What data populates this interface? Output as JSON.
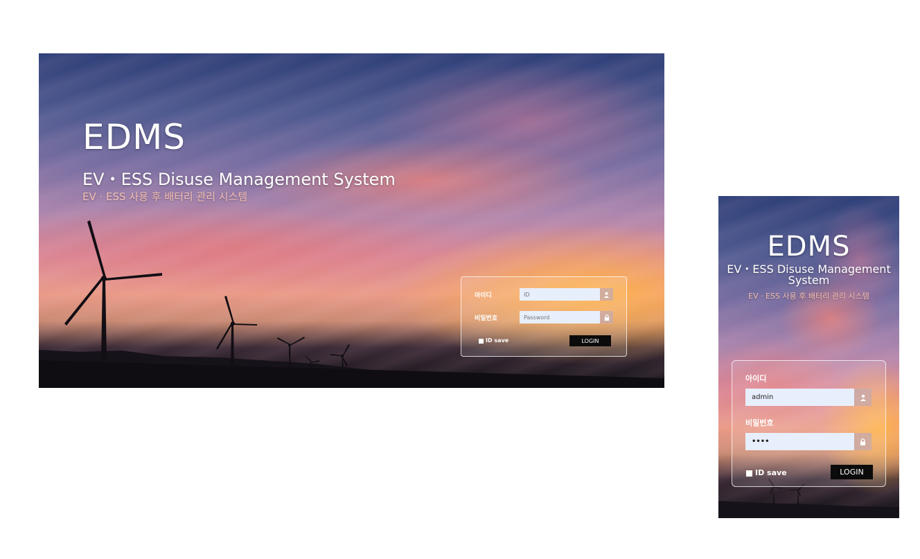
{
  "desktop": {
    "title": "EDMS",
    "subtitle": "EV・ESS Disuse Management System",
    "subtitle_ko": "EV · ESS 사용 후 배터리 관리 시스템",
    "login": {
      "id_label": "아이디",
      "id_value": "",
      "id_placeholder": "ID",
      "password_label": "비밀번호",
      "password_value": "",
      "password_placeholder": "Password",
      "id_save_label": "ID save",
      "login_button": "LOGIN",
      "id_icon": "user-icon",
      "password_icon": "lock-icon"
    }
  },
  "mobile": {
    "title": "EDMS",
    "subtitle": "EV・ESS Disuse Management System",
    "subtitle_ko": "EV · ESS 사용 후 배터리 관리 시스템",
    "login": {
      "id_label": "아이디",
      "id_value": "admin",
      "password_label": "비밀번호",
      "password_value": "••••",
      "id_save_label": "ID save",
      "login_button": "LOGIN",
      "id_icon": "user-icon",
      "password_icon": "lock-icon"
    }
  },
  "colors": {
    "subtitle_ko": "#f4c0b4",
    "input_bg": "#e8effc",
    "button_bg": "#0b0b0b"
  }
}
